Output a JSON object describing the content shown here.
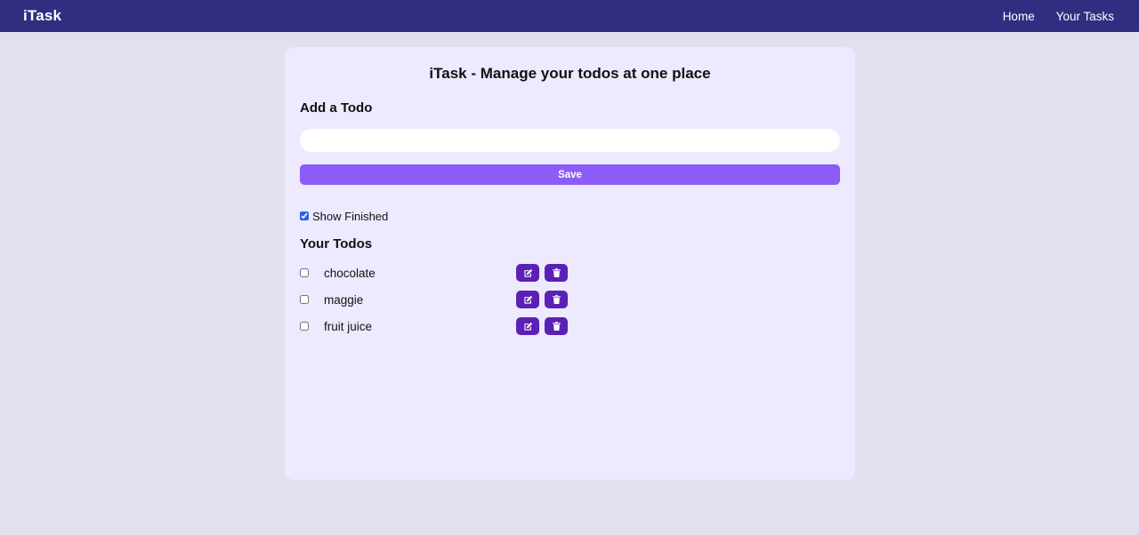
{
  "navbar": {
    "brand": "iTask",
    "links": [
      "Home",
      "Your Tasks"
    ]
  },
  "main": {
    "title": "iTask - Manage your todos at one place",
    "add_title": "Add a Todo",
    "input": {
      "value": "",
      "placeholder": ""
    },
    "save_label": "Save",
    "show_finished": {
      "label": "Show Finished",
      "checked": true
    },
    "todos_title": "Your Todos",
    "todos": [
      {
        "text": "chocolate",
        "done": false
      },
      {
        "text": "maggie",
        "done": false
      },
      {
        "text": "fruit juice",
        "done": false
      }
    ]
  },
  "colors": {
    "navbar": "#312e81",
    "card": "#ede9fe",
    "save_button": "#8b5cf6",
    "action_button": "#5b21b6",
    "page_background": "#e2e0ee"
  },
  "icons": {
    "edit": "edit-icon",
    "delete": "trash-icon"
  }
}
